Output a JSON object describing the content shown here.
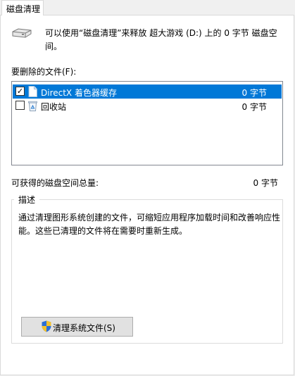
{
  "tab": {
    "label": "磁盘清理"
  },
  "intro": {
    "text": "可以使用“磁盘清理”来释放 超大游戏 (D:) 上的 0 字节 磁盘空间。"
  },
  "files": {
    "label": "要删除的文件(F):",
    "items": [
      {
        "name": "DirectX 着色器缓存",
        "size": "0 字节",
        "checked": true,
        "selected": true,
        "icon": "document-icon"
      },
      {
        "name": "回收站",
        "size": "0 字节",
        "checked": false,
        "selected": false,
        "icon": "recycle-bin-icon"
      }
    ]
  },
  "total": {
    "label": "可获得的磁盘空间总量:",
    "value": "0 字节"
  },
  "description": {
    "title": "描述",
    "text": "通过清理图形系统创建的文件，可缩短应用程序加载时间和改善响应性能。这些已清理的文件将在需要时重新生成。"
  },
  "clean_button": {
    "label": "清理系统文件(S)",
    "icon": "shield-icon"
  },
  "colors": {
    "selection": "#0078d7"
  }
}
